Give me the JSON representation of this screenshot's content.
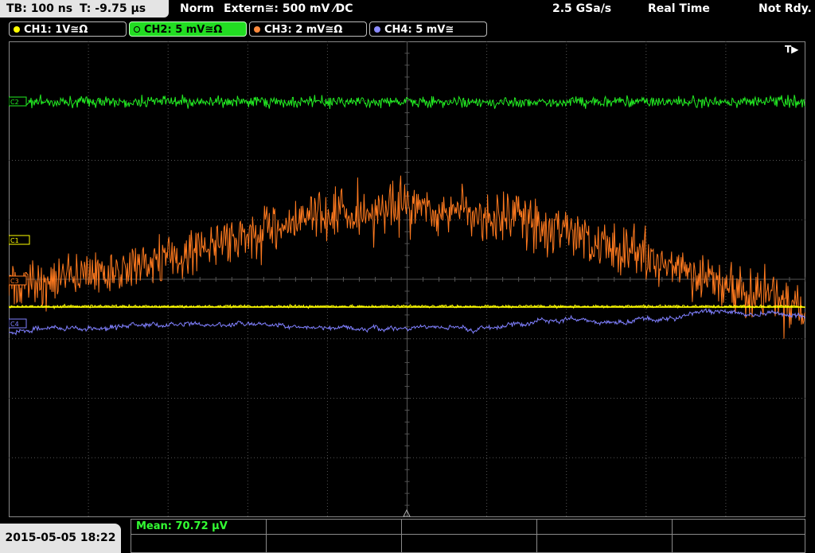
{
  "status_bar": {
    "timebase": "TB: 100 ns",
    "trigger_time": "T: -9.75 µs",
    "mode": "Norm",
    "trigger": "Extern≅: 500 mV ⁄DC",
    "sample_rate": "2.5 GSa/s",
    "acquisition": "Real Time",
    "ready_state": "Not Rdy."
  },
  "channels": [
    {
      "label": "CH1: 1V≅Ω",
      "color": "#ffff00",
      "active": false
    },
    {
      "label": "CH2: 5 mV≅Ω",
      "color": "#22dd22",
      "active": true
    },
    {
      "label": "CH3: 2 mV≅Ω",
      "color": "#ff8a3d",
      "active": false
    },
    {
      "label": "CH4: 5 mV≅",
      "color": "#8b8bff",
      "active": false
    }
  ],
  "markers": {
    "c1": "C1",
    "c2": "C2",
    "c3": "C3",
    "c4": "C4",
    "trigger_pos": "T▶"
  },
  "colors": {
    "ch1": "#ffff00",
    "ch2": "#22ee22",
    "ch3": "#ff7a1f",
    "ch4": "#8080ff",
    "grid": "#555555"
  },
  "footer": {
    "datetime": "2015-05-05 18:22",
    "measurement": "Mean: 70.72 µV"
  }
}
